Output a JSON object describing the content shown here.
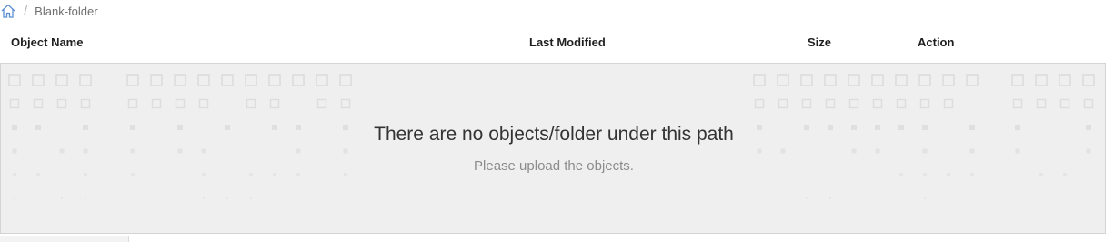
{
  "breadcrumb": {
    "home_icon": "home-icon",
    "separator": "/",
    "current": "Blank-folder"
  },
  "table": {
    "columns": [
      "Object Name",
      "Last Modified",
      "Size",
      "Action"
    ]
  },
  "empty_state": {
    "title": "There are no objects/folder under this path",
    "subtitle": "Please upload the objects."
  },
  "colors": {
    "panel_bg": "#efefef",
    "panel_border": "#d4d4d4",
    "home_icon": "#5b8fd6",
    "pattern": "#d9d9d9"
  }
}
